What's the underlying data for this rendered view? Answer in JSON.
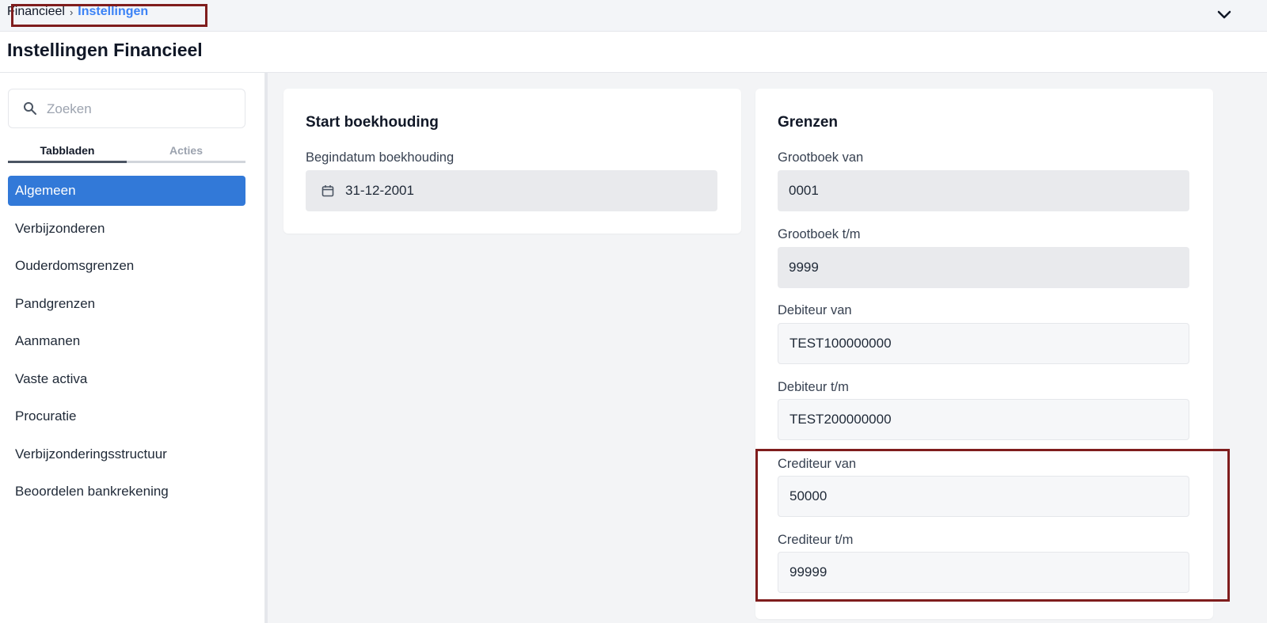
{
  "breadcrumb": {
    "parent": "Financieel",
    "separator": "›",
    "current": "Instellingen"
  },
  "page": {
    "title": "Instellingen Financieel"
  },
  "sidebar": {
    "search_placeholder": "Zoeken",
    "tabs": [
      {
        "label": "Tabbladen",
        "active": true
      },
      {
        "label": "Acties",
        "active": false
      }
    ],
    "items": [
      {
        "label": "Algemeen",
        "active": true
      },
      {
        "label": "Verbijzonderen"
      },
      {
        "label": "Ouderdomsgrenzen"
      },
      {
        "label": "Pandgrenzen"
      },
      {
        "label": "Aanmanen"
      },
      {
        "label": "Vaste activa"
      },
      {
        "label": "Procuratie"
      },
      {
        "label": "Verbijzonderingsstructuur"
      },
      {
        "label": "Beoordelen bankrekening"
      }
    ]
  },
  "start": {
    "title": "Start boekhouding",
    "begindatum_label": "Begindatum boekhouding",
    "begindatum_value": "31-12-2001"
  },
  "grenzen": {
    "title": "Grenzen",
    "grootboek_van_label": "Grootboek van",
    "grootboek_van_value": "0001",
    "grootboek_tm_label": "Grootboek t/m",
    "grootboek_tm_value": "9999",
    "debiteur_van_label": "Debiteur van",
    "debiteur_van_value": "TEST100000000",
    "debiteur_tm_label": "Debiteur t/m",
    "debiteur_tm_value": "TEST200000000",
    "crediteur_van_label": "Crediteur van",
    "crediteur_van_value": "50000",
    "crediteur_tm_label": "Crediteur t/m",
    "crediteur_tm_value": "99999"
  },
  "colors": {
    "accent": "#3279d8",
    "breadcrumb_current": "#3b82f6",
    "highlight": "#7f1d1d"
  },
  "icons": {
    "search": "search-icon",
    "calendar": "calendar-icon",
    "chevron": "chevron-down-icon"
  }
}
